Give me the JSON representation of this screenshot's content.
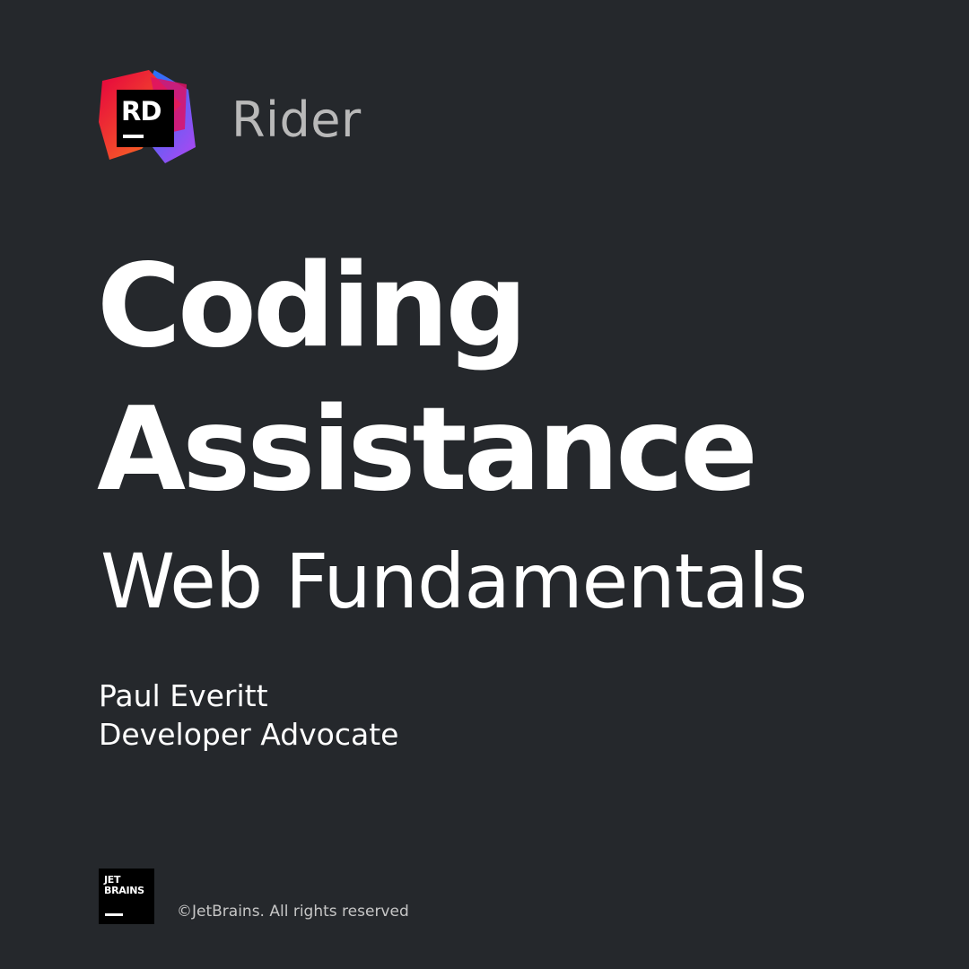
{
  "logo": {
    "icon": "rider-logo-icon",
    "letters": "RD",
    "colors": [
      "#e5003f",
      "#fc801d",
      "#087cfa",
      "#b345f1",
      "#000000"
    ]
  },
  "product_name": "Rider",
  "title": {
    "line1": "Coding",
    "line2": "Assistance"
  },
  "subtitle": "Web Fundamentals",
  "author": {
    "name": "Paul Everitt",
    "role": "Developer Advocate"
  },
  "footer": {
    "jetbrains_logo": {
      "icon": "jetbrains-logo-icon",
      "line1": "JET",
      "line2": "BRAINS"
    },
    "copyright": "©JetBrains. All rights reserved"
  },
  "colors": {
    "background": "#25282c",
    "text": "#ffffff",
    "muted_text": "#b9b9b9"
  }
}
